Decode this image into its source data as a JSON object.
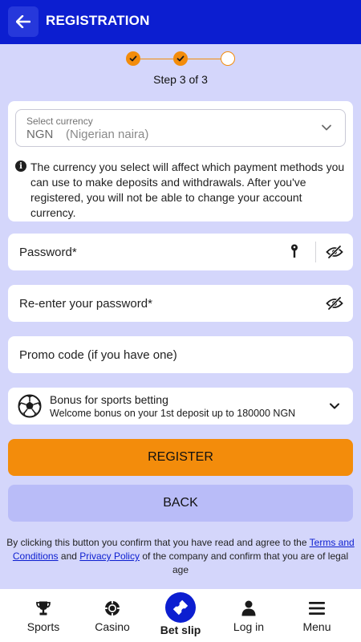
{
  "header": {
    "title": "REGISTRATION",
    "back_icon": "arrow-left-icon"
  },
  "stepper": {
    "total": 3,
    "completed": 2,
    "text": "Step 3 of 3",
    "accent": "#f38c0b"
  },
  "currency": {
    "label": "Select currency",
    "code": "NGN",
    "name": "(Nigerian naira)",
    "info": "The currency you select will affect which payment methods you can use to make deposits and withdrawals. After you've registered, you will not be able to change your account currency."
  },
  "fields": {
    "password": "Password*",
    "reenter_password": "Re-enter your password*",
    "promo": "Promo code (if you have one)"
  },
  "bonus": {
    "title": "Bonus for sports betting",
    "subtitle": "Welcome bonus on your 1st deposit up to 180000 NGN"
  },
  "buttons": {
    "register": "REGISTER",
    "back": "BACK"
  },
  "terms": {
    "prefix": "By clicking this button you confirm that you have read and agree to the",
    "terms_link": "Terms and Conditions",
    "and": "and",
    "privacy_link": "Privacy Policy",
    "suffix": "of the company and confirm that you are of legal age"
  },
  "nav": {
    "sports": "Sports",
    "casino": "Casino",
    "betslip": "Bet slip",
    "login": "Log in",
    "menu": "Menu"
  },
  "colors": {
    "brand": "#0c1ed0",
    "accent": "#f38c0b",
    "background": "#d4d6fb",
    "secondary_button": "#b9bcf8"
  }
}
